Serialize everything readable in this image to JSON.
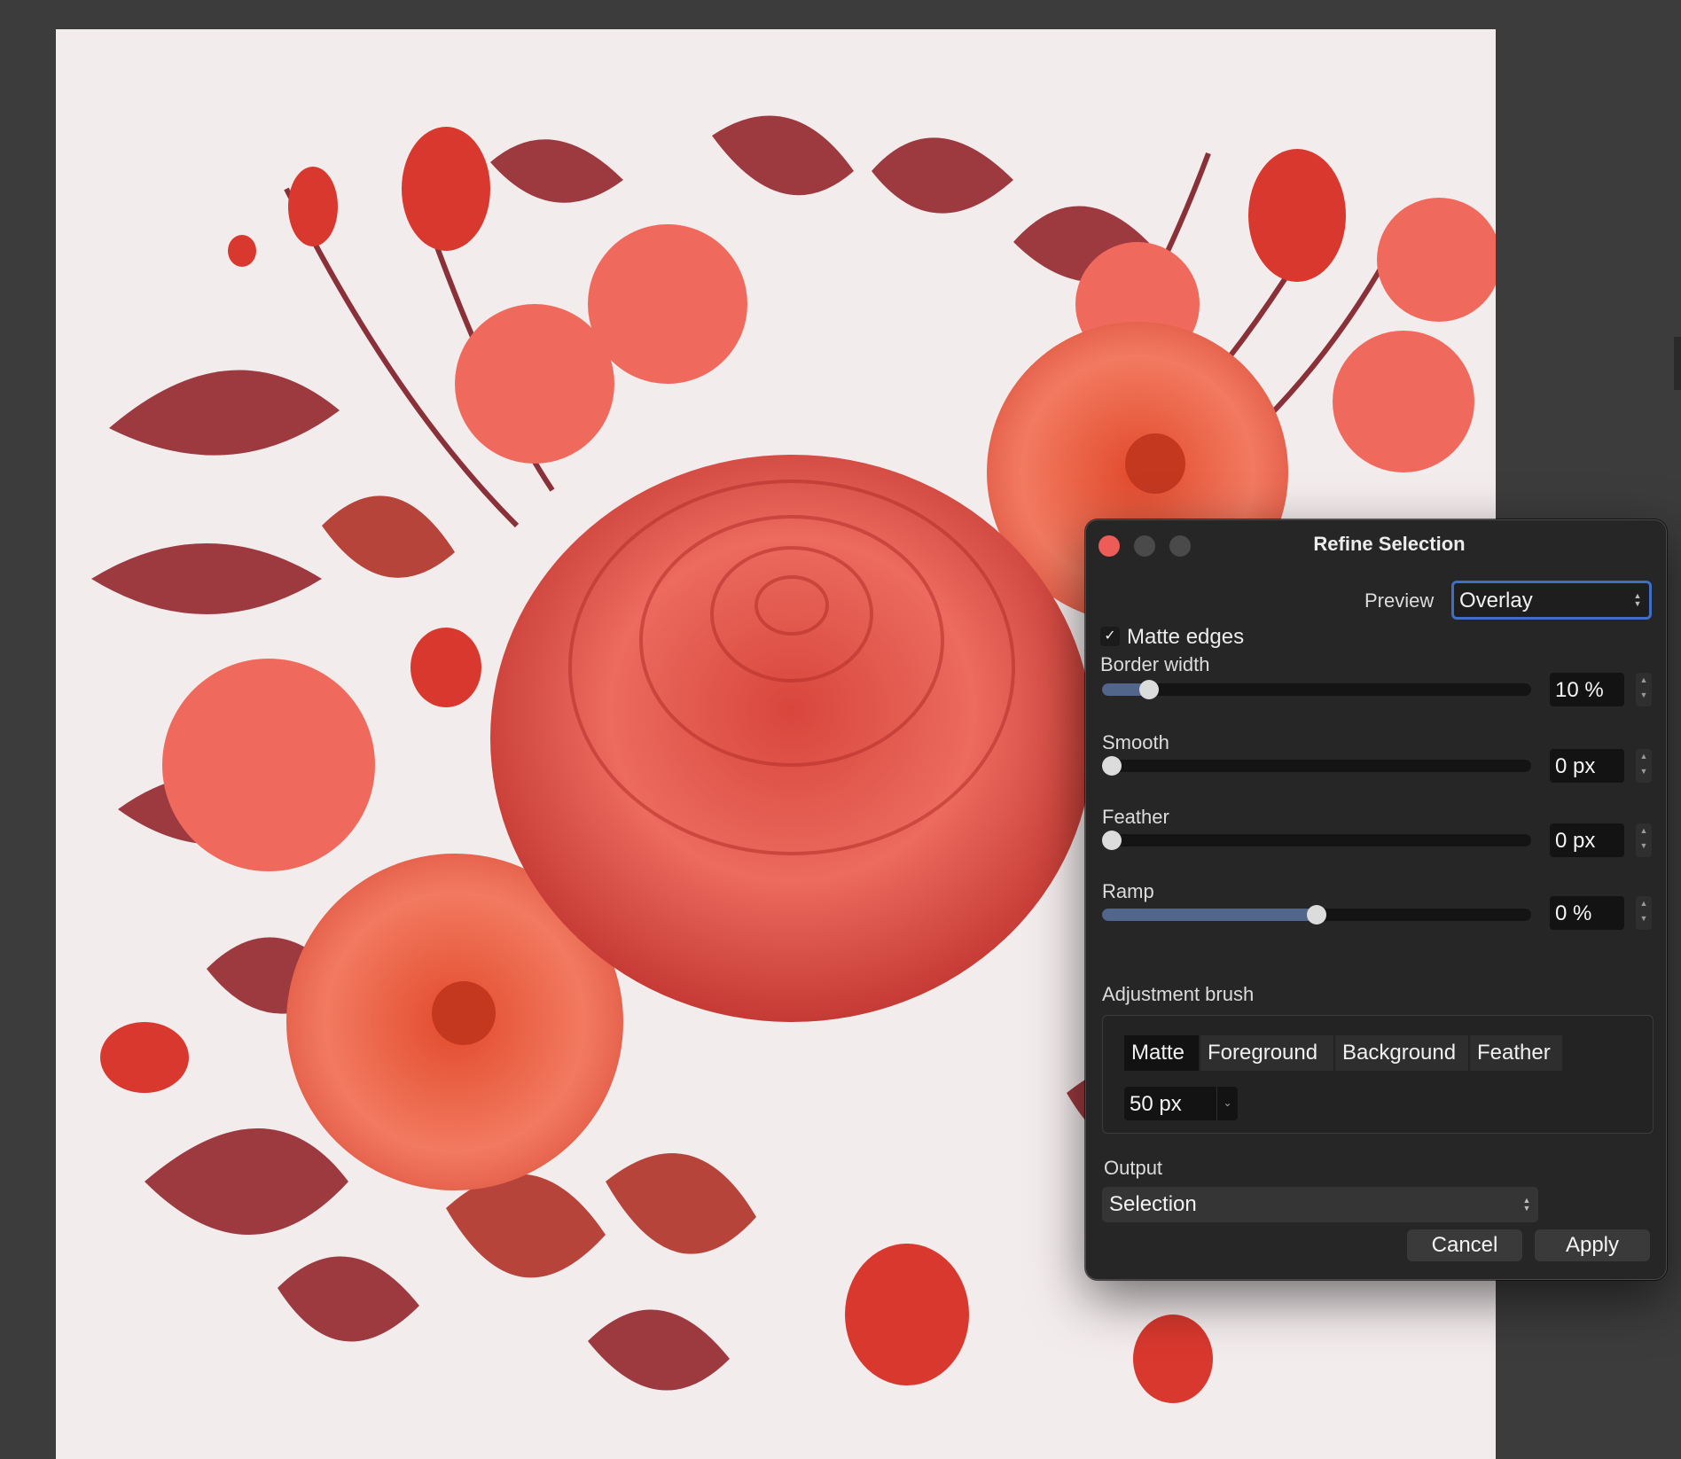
{
  "dialog": {
    "title": "Refine Selection",
    "preview_label": "Preview",
    "preview_value": "Overlay",
    "matte_edges_label": "Matte edges",
    "matte_edges_checked": true,
    "sliders": [
      {
        "label": "Border width",
        "value": 10,
        "display": "10 %",
        "fraction": 0.11
      },
      {
        "label": "Smooth",
        "value": 0,
        "display": "0 px",
        "fraction": 0.0
      },
      {
        "label": "Feather",
        "value": 0,
        "display": "0 px",
        "fraction": 0.0
      },
      {
        "label": "Ramp",
        "value": 0,
        "display": "0 %",
        "fraction": 0.5
      }
    ],
    "adjustment_brush_label": "Adjustment brush",
    "brush_modes": [
      "Matte",
      "Foreground",
      "Background",
      "Feather"
    ],
    "brush_mode_selected": "Matte",
    "brush_size": "50 px",
    "output_label": "Output",
    "output_value": "Selection",
    "cancel_label": "Cancel",
    "apply_label": "Apply"
  },
  "colors": {
    "accent": "#3e6fc4",
    "close": "#ee5c57",
    "slider_fill": "#52658a",
    "canvas_bg": "#f3eced"
  },
  "icons": {
    "checkmark": "checkmark-icon",
    "updown": "chevron-updown-icon",
    "dropdown": "chevron-down-icon"
  }
}
